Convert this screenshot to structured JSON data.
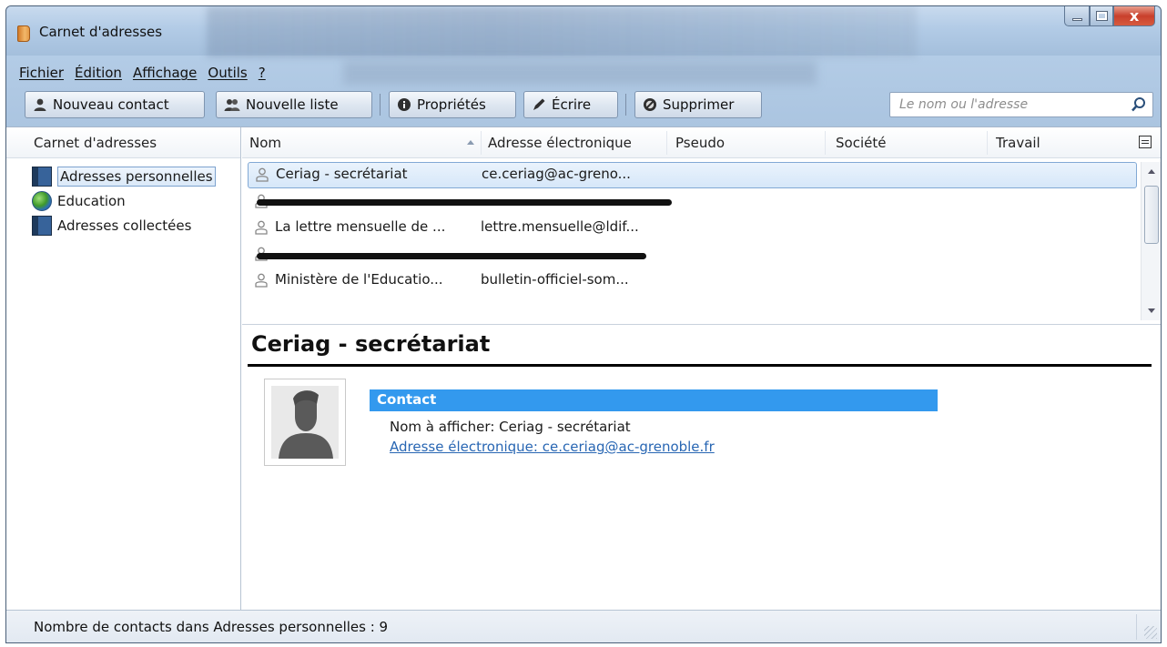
{
  "window": {
    "title": "Carnet d'adresses",
    "controls": {
      "minimize": "minimize",
      "maximize": "maximize",
      "close": "x"
    }
  },
  "menu": [
    "Fichier",
    "Édition",
    "Affichage",
    "Outils",
    "?"
  ],
  "toolbar": {
    "new_contact": "Nouveau contact",
    "new_list": "Nouvelle liste",
    "properties": "Propriétés",
    "write": "Écrire",
    "delete": "Supprimer"
  },
  "search": {
    "placeholder": "Le nom ou l'adresse",
    "icon": "search-icon"
  },
  "sidebar": {
    "header": "Carnet d'adresses",
    "items": [
      {
        "label": "Adresses personnelles",
        "icon": "address-book-icon",
        "selected": true
      },
      {
        "label": "Education",
        "icon": "globe-icon",
        "selected": false
      },
      {
        "label": "Adresses collectées",
        "icon": "address-book-icon",
        "selected": false
      }
    ]
  },
  "table": {
    "columns": [
      "Nom",
      "Adresse électronique",
      "Pseudo",
      "Société",
      "Travail"
    ],
    "rows": [
      {
        "name": "Ceriag - secrétariat",
        "email": "ce.ceriag@ac-greno...",
        "redacted": false,
        "selected": true
      },
      {
        "name": "",
        "email": "",
        "redacted": true,
        "selected": false
      },
      {
        "name": "La lettre mensuelle de ...",
        "email": "lettre.mensuelle@ldif...",
        "redacted": false,
        "selected": false
      },
      {
        "name": "",
        "email": "",
        "redacted": true,
        "selected": false
      },
      {
        "name": "Ministère de l'Educatio...",
        "email": "bulletin-officiel-som...",
        "redacted": false,
        "selected": false
      }
    ]
  },
  "detail": {
    "title": "Ceriag - secrétariat",
    "section": "Contact",
    "display_name": "Nom à afficher: Ceriag - secrétariat",
    "email": "Adresse électronique: ce.ceriag@ac-grenoble.fr"
  },
  "status": {
    "text": "Nombre de contacts dans Adresses personnelles : 9"
  },
  "colors": {
    "accent": "#3399ee",
    "link": "#2866b3",
    "selection": "#d6e7f9"
  }
}
